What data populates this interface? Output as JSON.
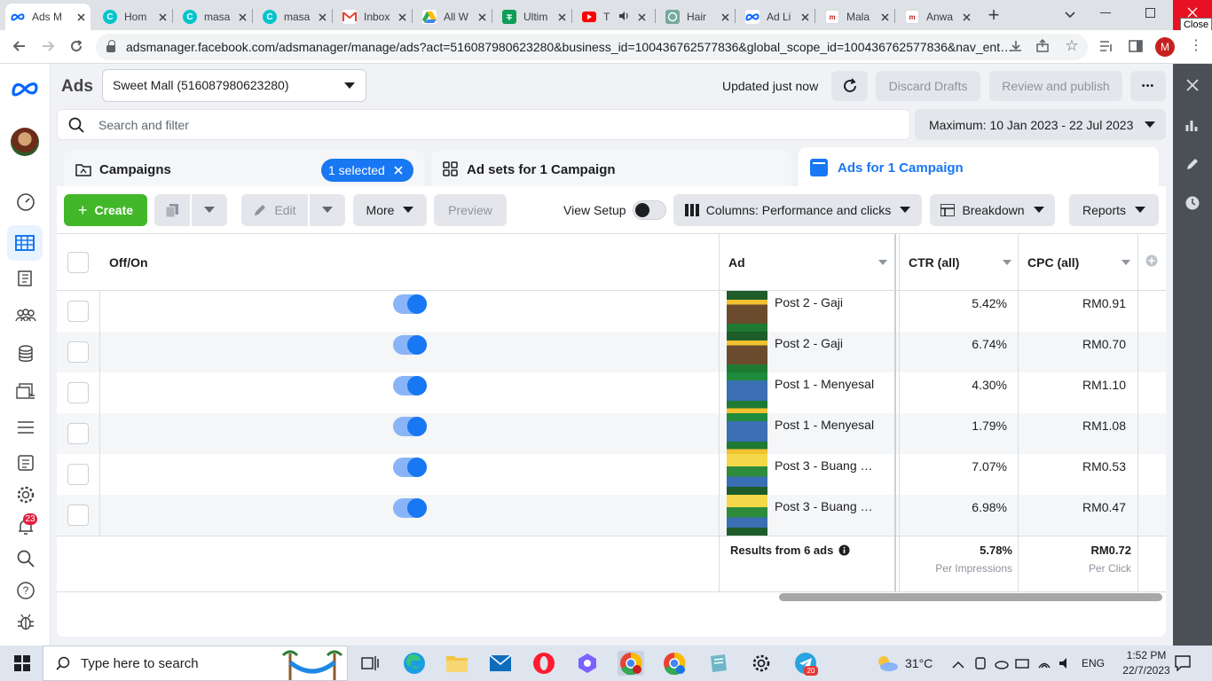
{
  "browser": {
    "tabs": [
      {
        "title": "Ads M",
        "icon": "meta-icon",
        "active": true
      },
      {
        "title": "Hom",
        "icon": "canva-icon"
      },
      {
        "title": "masa",
        "icon": "canva-icon"
      },
      {
        "title": "masa",
        "icon": "canva-icon"
      },
      {
        "title": "Inbox",
        "icon": "gmail-icon"
      },
      {
        "title": "All W",
        "icon": "drive-icon"
      },
      {
        "title": "Ultim",
        "icon": "sheets-icon"
      },
      {
        "title": "T",
        "icon": "youtube-icon"
      },
      {
        "title": "Hair",
        "icon": "chatgpt-icon"
      },
      {
        "title": "Ad Li",
        "icon": "meta-icon"
      },
      {
        "title": "Mala",
        "icon": "site-icon"
      },
      {
        "title": "Anwa",
        "icon": "site-icon"
      }
    ],
    "new_tab_symbol": "+",
    "url": "adsmanager.facebook.com/adsmanager/manage/ads?act=516087980623280&business_id=100436762577836&global_scope_id=100436762577836&nav_ent…",
    "profile_initial": "M",
    "close_tooltip": "Close"
  },
  "header": {
    "title": "Ads",
    "account": "Sweet Mall (516087980623280)",
    "updated": "Updated just now",
    "discard": "Discard Drafts",
    "review": "Review and publish",
    "more_symbol": "•••"
  },
  "search": {
    "placeholder": "Search and filter",
    "date_range": "Maximum: 10 Jan 2023 - 22 Jul 2023"
  },
  "level_tabs": {
    "campaigns": "Campaigns",
    "selected": "1 selected",
    "adsets": "Ad sets for 1 Campaign",
    "ads": "Ads for 1 Campaign"
  },
  "toolbar": {
    "create": "Create",
    "edit": "Edit",
    "more": "More",
    "preview": "Preview",
    "view_setup": "View Setup",
    "columns": "Columns: Performance and clicks",
    "breakdown": "Breakdown",
    "reports": "Reports"
  },
  "table": {
    "headers": {
      "offon": "Off/On",
      "ad": "Ad",
      "ctr": "CTR (all)",
      "cpc": "CPC (all)"
    },
    "rows": [
      {
        "ad": "Post 2 - Gaji",
        "ctr": "5.42%",
        "cpc": "RM0.91",
        "on": true,
        "thumb": "green"
      },
      {
        "ad": "Post 2 - Gaji",
        "ctr": "6.74%",
        "cpc": "RM0.70",
        "on": true,
        "thumb": "green"
      },
      {
        "ad": "Post 1 - Menyesal",
        "ctr": "4.30%",
        "cpc": "RM1.10",
        "on": true,
        "thumb": "blue"
      },
      {
        "ad": "Post 1 - Menyesal",
        "ctr": "1.79%",
        "cpc": "RM1.08",
        "on": true,
        "thumb": "blue"
      },
      {
        "ad": "Post 3 - Buang m…",
        "ctr": "7.07%",
        "cpc": "RM0.53",
        "on": true,
        "thumb": "yellow"
      },
      {
        "ad": "Post 3 - Buang m…",
        "ctr": "6.98%",
        "cpc": "RM0.47",
        "on": true,
        "thumb": "yellow"
      }
    ],
    "summary": {
      "label": "Results from 6 ads",
      "ctr": "5.78%",
      "ctr_sub": "Per Impressions",
      "cpc": "RM0.72",
      "cpc_sub": "Per Click"
    }
  },
  "leftnav": {
    "notifications_badge": "23"
  },
  "taskbar": {
    "search_placeholder": "Type here to search",
    "weather": "31°C",
    "lang": "ENG",
    "time": "1:52 PM",
    "date": "22/7/2023",
    "telegram_badge": "20"
  },
  "colors": {
    "accent": "#1877f2",
    "create_green": "#42b72a",
    "meta_blue": "#0866ff"
  }
}
